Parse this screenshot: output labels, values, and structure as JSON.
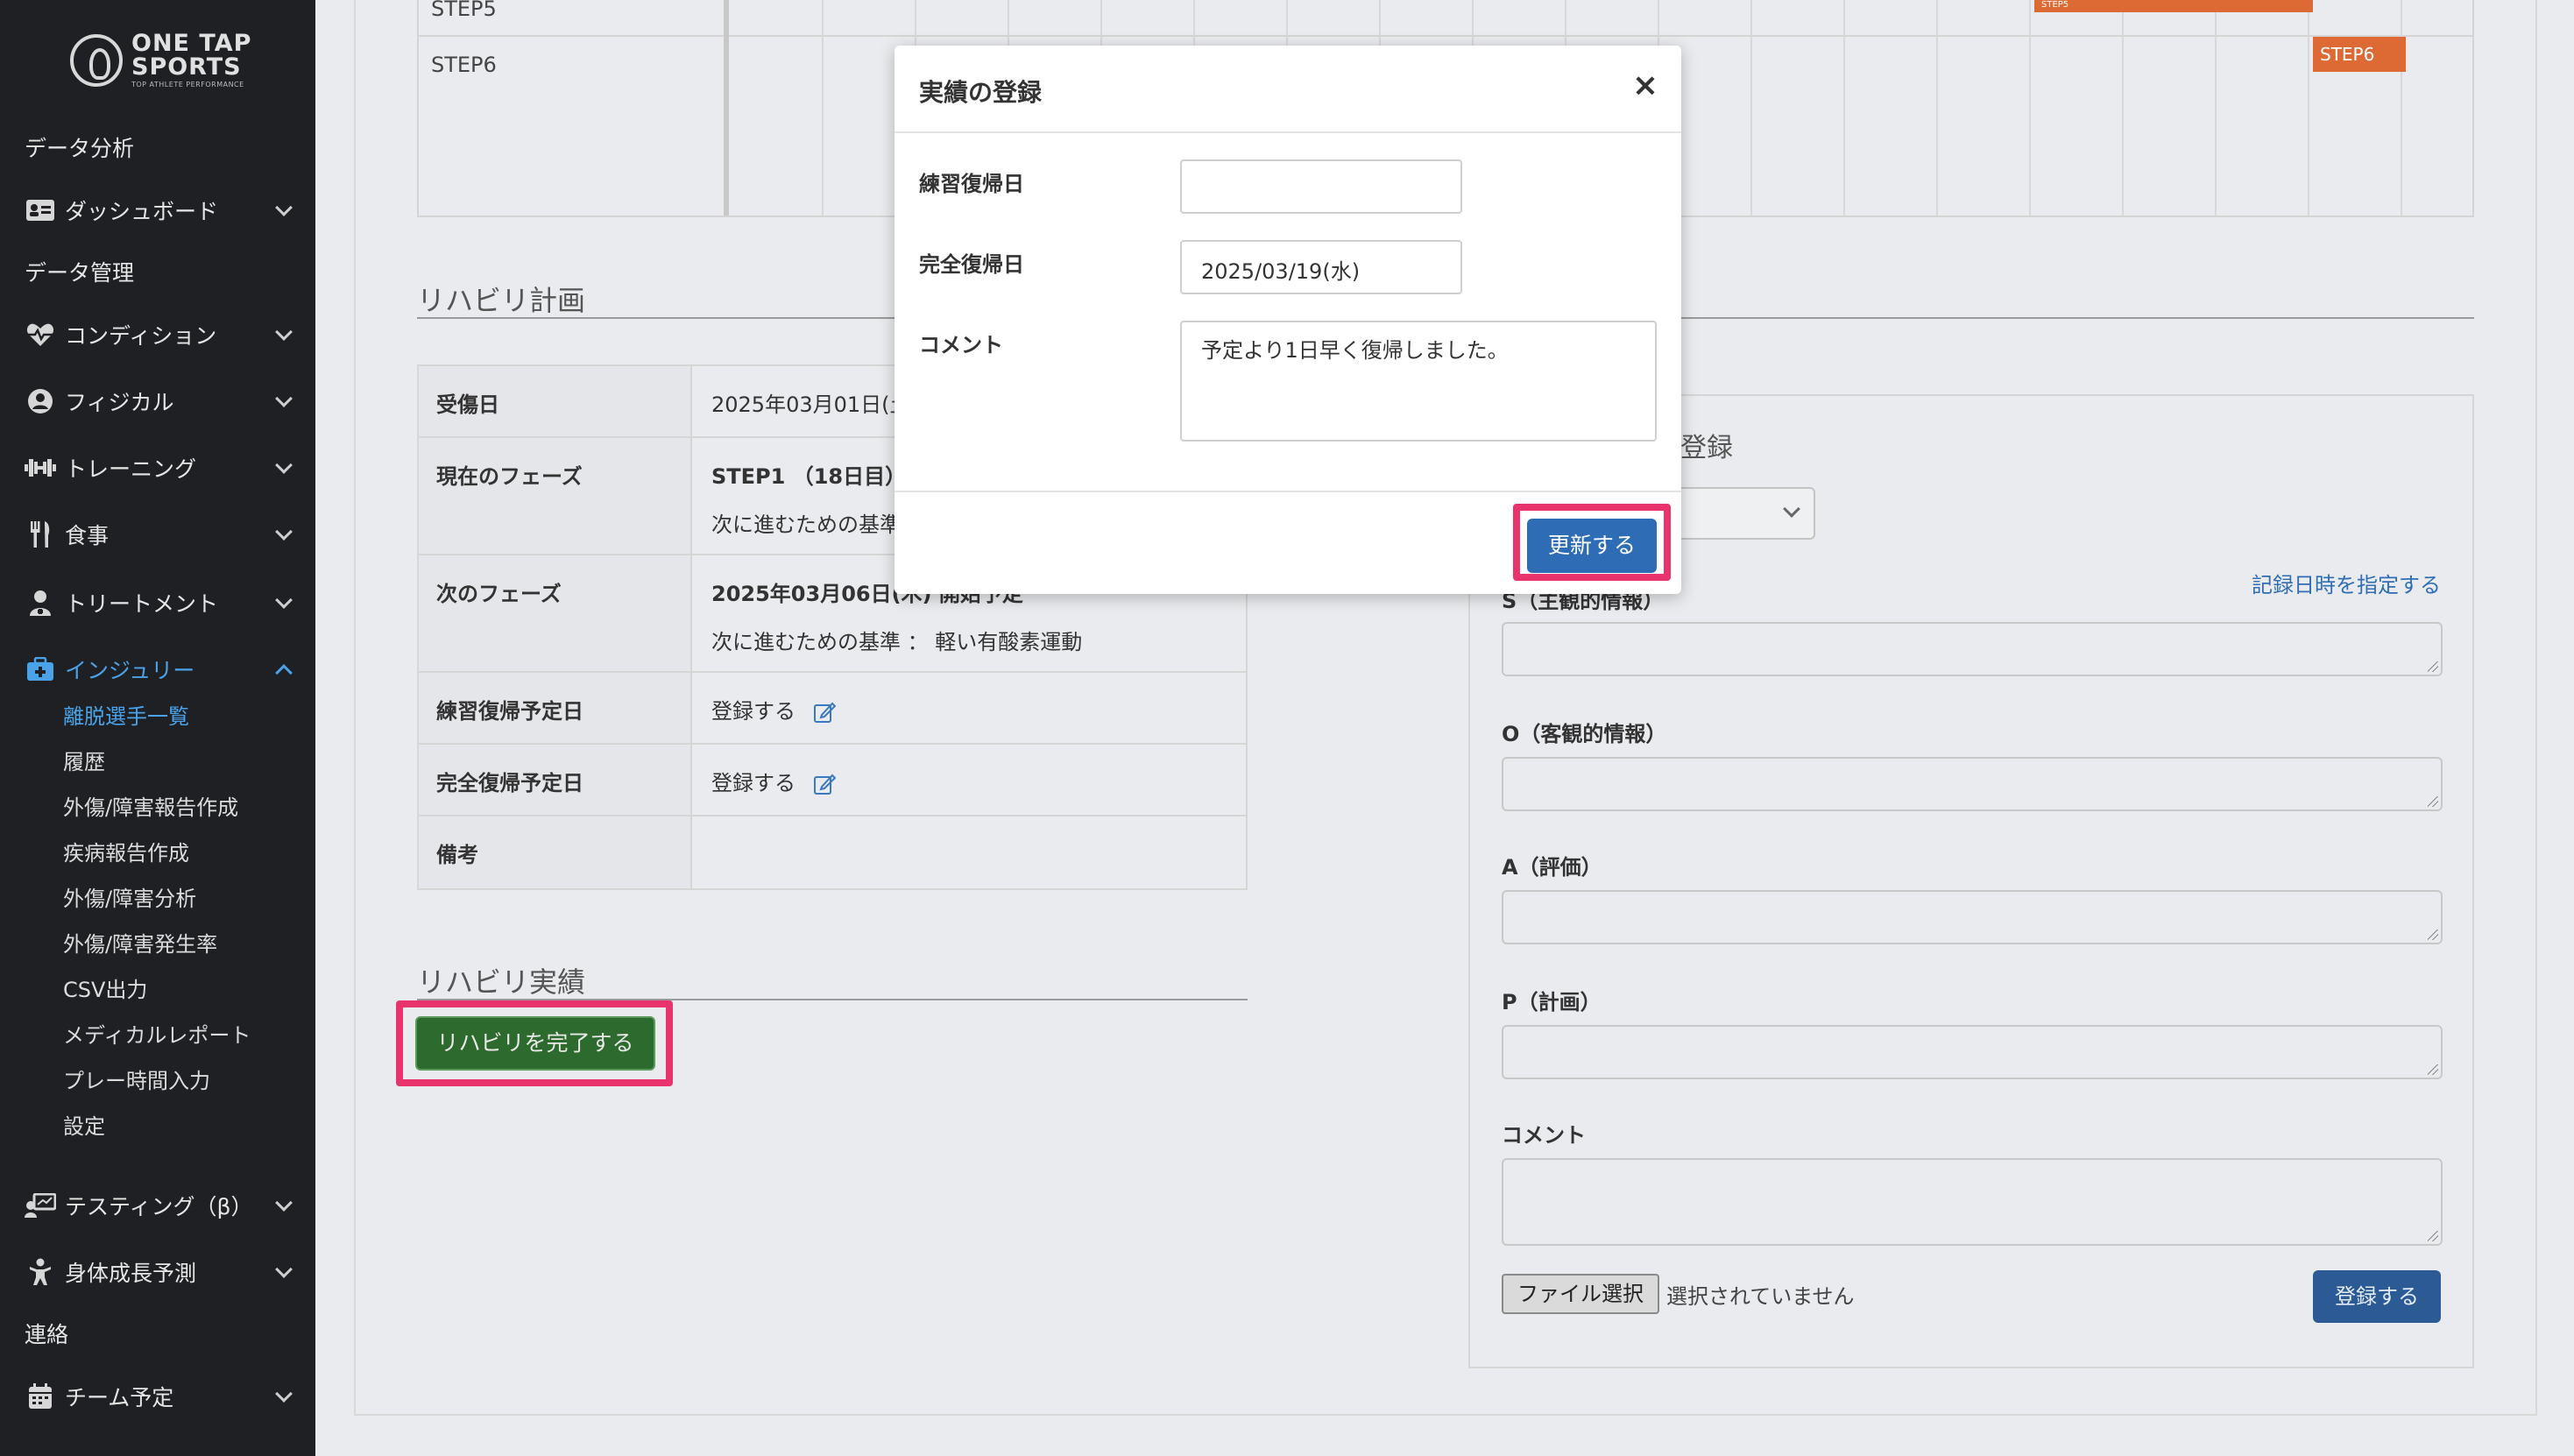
{
  "sidebar": {
    "logo": {
      "line1": "ONE TAP",
      "line2": "SPORTS",
      "tagline": "TOP ATHLETE PERFORMANCE"
    },
    "items": [
      {
        "label": "データ分析"
      },
      {
        "label": "ダッシュボード",
        "icon": "id-card-icon"
      },
      {
        "label": "データ管理"
      },
      {
        "label": "コンディション",
        "icon": "heart-pulse-icon"
      },
      {
        "label": "フィジカル",
        "icon": "user-circle-icon"
      },
      {
        "label": "トレーニング",
        "icon": "dumbbell-icon"
      },
      {
        "label": "食事",
        "icon": "utensils-icon"
      },
      {
        "label": "トリートメント",
        "icon": "user-medical-icon"
      },
      {
        "label": "インジュリー",
        "icon": "medkit-icon"
      },
      {
        "label": "テスティング（β）",
        "icon": "chalkboard-user-icon"
      },
      {
        "label": "身体成長予測",
        "icon": "child-icon"
      },
      {
        "label": "連絡"
      },
      {
        "label": "チーム予定",
        "icon": "calendar-icon"
      }
    ],
    "injury_sub": [
      "離脱選手一覧",
      "履歴",
      "外傷/障害報告作成",
      "疾病報告作成",
      "外傷/障害分析",
      "外傷/障害発生率",
      "CSV出力",
      "メディカルレポート",
      "プレー時間入力",
      "設定"
    ]
  },
  "gantt": {
    "rows": [
      {
        "label": "STEP5",
        "bar": "STEP5"
      },
      {
        "label": "STEP6",
        "bar": "STEP6"
      }
    ]
  },
  "plan": {
    "title": "リハビリ計画",
    "rows": [
      {
        "th": "受傷日",
        "td": "2025年03月01日(土)"
      },
      {
        "th": "現在のフェーズ",
        "td": "STEP1 （18日目）",
        "td2": "次に進むための基準 ： ..."
      },
      {
        "th": "次のフェーズ",
        "td": "2025年03月06日(木) 開始予定",
        "td2": "次に進むための基準 ： 軽い有酸素運動"
      },
      {
        "th": "練習復帰予定日",
        "td": "登録する"
      },
      {
        "th": "完全復帰予定日",
        "td": "登録する"
      },
      {
        "th": "備考",
        "td": ""
      }
    ]
  },
  "results": {
    "title": "リハビリ実績",
    "complete_button": "リハビリを完了する"
  },
  "soap": {
    "title": "登録",
    "record_time_link": "記録日時を指定する",
    "s_label": "S（主観的情報）",
    "o_label": "O（客観的情報）",
    "a_label": "A（評価）",
    "p_label": "P（計画）",
    "comment_label": "コメント",
    "file_button": "ファイル選択",
    "file_status": "選択されていません",
    "register_button": "登録する"
  },
  "modal": {
    "title": "実績の登録",
    "close": "×",
    "practice_return_label": "練習復帰日",
    "practice_return_value": "",
    "full_return_label": "完全復帰日",
    "full_return_value": "2025/03/19(水)",
    "comment_label": "コメント",
    "comment_value": "予定より1日早く復帰しました。",
    "update_button": "更新する"
  },
  "colors": {
    "accent": "#2e6cb5",
    "highlight": "#e8336c",
    "gantt_bar": "#dd6a35",
    "complete_green": "#2d6a2d"
  }
}
